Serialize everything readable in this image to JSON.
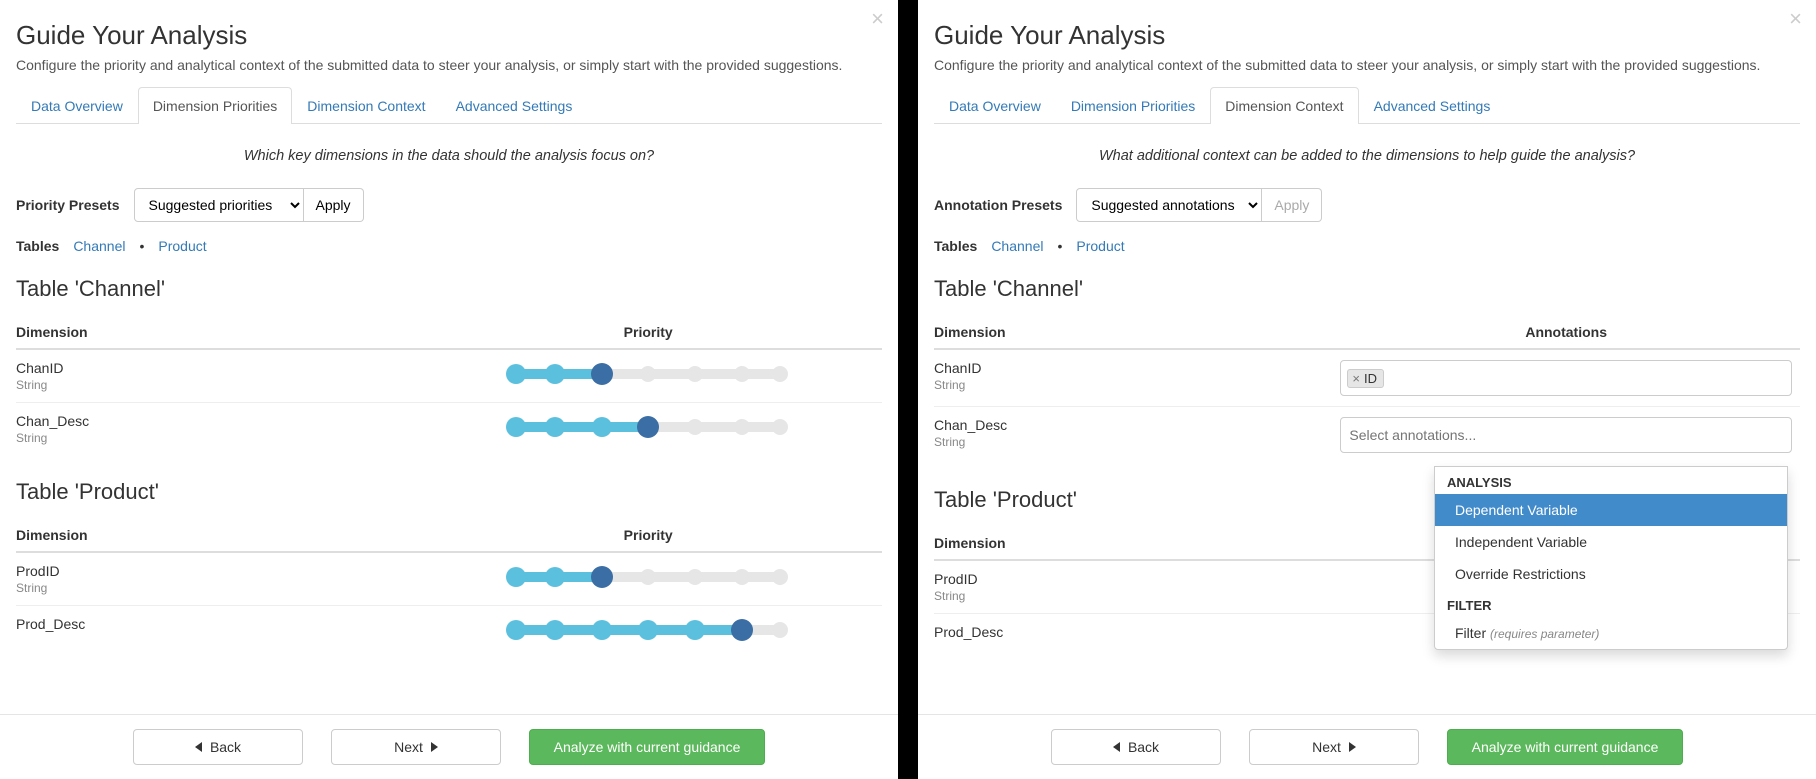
{
  "shared": {
    "title": "Guide Your Analysis",
    "subtitle": "Configure the priority and analytical context of the submitted data to steer your analysis, or simply start with the provided suggestions.",
    "tabs": [
      "Data Overview",
      "Dimension Priorities",
      "Dimension Context",
      "Advanced Settings"
    ],
    "tables_label": "Tables",
    "table_links": [
      "Channel",
      "Product"
    ],
    "footer": {
      "back": "Back",
      "next": "Next",
      "analyze": "Analyze with current guidance"
    }
  },
  "left": {
    "active_tab_index": 1,
    "question": "Which key dimensions in the data should the analysis focus on?",
    "presets_label": "Priority Presets",
    "preset_selected": "Suggested priorities",
    "apply_label": "Apply",
    "column_dim": "Dimension",
    "column_priority": "Priority",
    "slider_steps": 7,
    "tables": [
      {
        "heading": "Table 'Channel'",
        "rows": [
          {
            "name": "ChanID",
            "type": "String",
            "priority_value": 3
          },
          {
            "name": "Chan_Desc",
            "type": "String",
            "priority_value": 4
          }
        ]
      },
      {
        "heading": "Table 'Product'",
        "rows": [
          {
            "name": "ProdID",
            "type": "String",
            "priority_value": 3
          },
          {
            "name": "Prod_Desc",
            "type": "",
            "priority_value": 6
          }
        ]
      }
    ]
  },
  "right": {
    "active_tab_index": 2,
    "question": "What additional context can be added to the dimensions to help guide the analysis?",
    "presets_label": "Annotation Presets",
    "preset_selected": "Suggested annotations",
    "apply_label": "Apply",
    "apply_disabled": true,
    "column_dim": "Dimension",
    "column_ann": "Annotations",
    "tables": [
      {
        "heading": "Table 'Channel'",
        "rows": [
          {
            "name": "ChanID",
            "type": "String",
            "tags": [
              "ID"
            ]
          },
          {
            "name": "Chan_Desc",
            "type": "String",
            "placeholder": "Select annotations...",
            "dropdown_open": true
          }
        ]
      },
      {
        "heading": "Table 'Product'",
        "rows": [
          {
            "name": "ProdID",
            "type": "String"
          },
          {
            "name": "Prod_Desc",
            "type": ""
          }
        ]
      }
    ],
    "dropdown": {
      "groups": [
        {
          "label": "ANALYSIS",
          "items": [
            {
              "label": "Dependent Variable",
              "highlighted": true
            },
            {
              "label": "Independent Variable"
            },
            {
              "label": "Override Restrictions"
            }
          ]
        },
        {
          "label": "FILTER",
          "items": [
            {
              "label": "Filter",
              "hint": "(requires parameter)"
            }
          ]
        }
      ]
    }
  }
}
